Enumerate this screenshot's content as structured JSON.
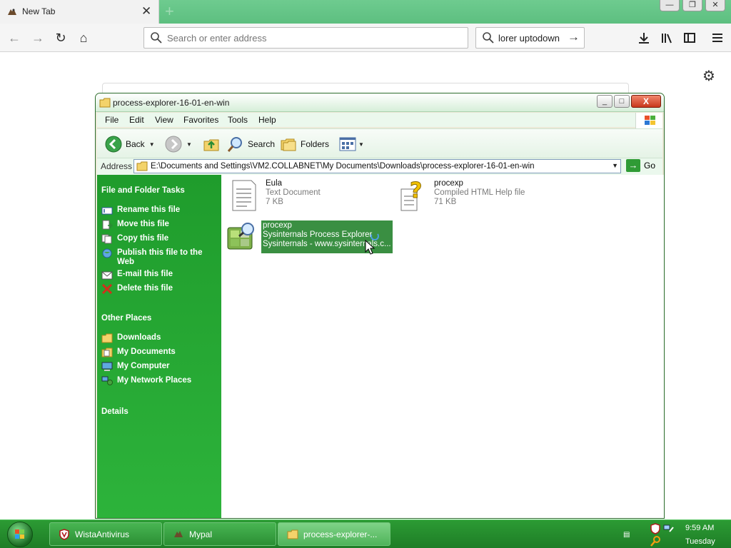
{
  "browser": {
    "tab": {
      "title": "New Tab",
      "close_glyph": "✕"
    },
    "new_tab_glyph": "+",
    "window_controls": [
      "—",
      "❐",
      "✕"
    ],
    "url": {
      "placeholder": "Search or enter address"
    },
    "search": {
      "query": "lorer uptodown",
      "go_glyph": "→"
    }
  },
  "explorer": {
    "title": "process-explorer-16-01-en-win",
    "title_controls": [
      "_",
      "□",
      "X"
    ],
    "menu": [
      "File",
      "Edit",
      "View",
      "Favorites",
      "Tools",
      "Help"
    ],
    "toolbar": {
      "back": "Back",
      "search": "Search",
      "folders": "Folders"
    },
    "address": {
      "label": "Address",
      "path": "E:\\Documents and Settings\\VM2.COLLABNET\\My Documents\\Downloads\\process-explorer-16-01-en-win",
      "go": "Go"
    },
    "sidebar": {
      "file_tasks": {
        "heading": "File and Folder Tasks",
        "items": [
          "Rename this file",
          "Move this file",
          "Copy this file",
          "Publish this file to the Web",
          "E-mail this file",
          "Delete this file"
        ]
      },
      "other_places": {
        "heading": "Other Places",
        "items": [
          "Downloads",
          "My Documents",
          "My Computer",
          "My Network Places"
        ]
      },
      "details": {
        "heading": "Details"
      }
    },
    "files": [
      {
        "name": "Eula",
        "line2": "Text Document",
        "line3": "7 KB"
      },
      {
        "name": "procexp",
        "line2": "Compiled HTML Help file",
        "line3": "71 KB"
      },
      {
        "name": "procexp",
        "line2": "Sysinternals Process Explorer",
        "line3": "Sysinternals - www.sysinternals.c..."
      }
    ]
  },
  "taskbar": {
    "tasks": [
      "WistaAntivirus",
      "Mypal",
      "process-explorer-..."
    ],
    "clock": {
      "time": "9:59 AM",
      "day": "Tuesday"
    }
  },
  "colors": {
    "theme_green": "#2aa336",
    "selection": "#3a8f42",
    "close_red": "#c8381c"
  }
}
